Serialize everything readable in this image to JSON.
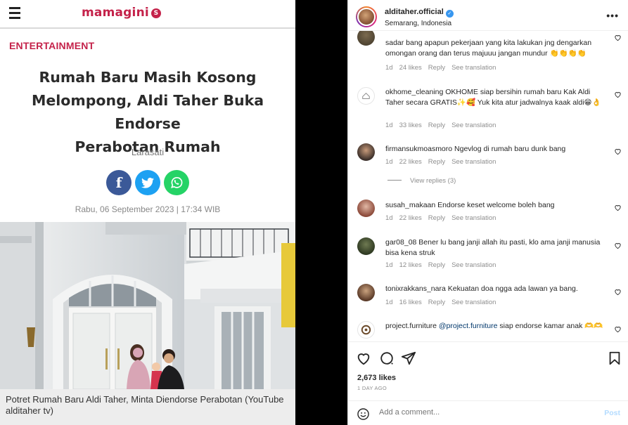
{
  "article": {
    "site_name": "mamagini",
    "logo_badge": "S",
    "category": "ENTERTAINMENT",
    "headline_lines": [
      "Rumah Baru Masih Kosong",
      "Melompong, Aldi Taher Buka Endorse",
      "Perabotan Rumah"
    ],
    "author": "Larasati",
    "share": {
      "facebook_glyph": "f"
    },
    "date": "Rabu, 06 September 2023 | 17:34 WIB",
    "caption": "Potret Rumah Baru Aldi Taher, Minta Diendorse Perabotan (YouTube alditaher tv)"
  },
  "instagram": {
    "username": "alditaher.official",
    "location": "Semarang, Indonesia",
    "more_label": "•••",
    "comments": [
      {
        "user": "",
        "text": "sadar bang apapun pekerjaan yang kita lakukan jng dengarkan omongan orang dan terus majuuu jangan mundur 👏👏👏👏",
        "time": "1d",
        "likes": "24 likes",
        "reply": "Reply",
        "translate": "See translation"
      },
      {
        "user": "okhome_cleaning",
        "text": "OKHOME siap bersihin rumah baru Kak Aldi Taher secara GRATIS✨🥰 Yuk kita atur jadwalnya kaak aldi😁👌",
        "time": "1d",
        "likes": "33 likes",
        "reply": "Reply",
        "translate": "See translation"
      },
      {
        "user": "firmansukmoasmoro",
        "text": "Ngevlog di rumah baru dunk bang",
        "time": "1d",
        "likes": "22 likes",
        "reply": "Reply",
        "translate": "See translation"
      },
      {
        "user": "susah_makaan",
        "text": "Endorse keset welcome boleh bang",
        "time": "1d",
        "likes": "22 likes",
        "reply": "Reply",
        "translate": "See translation"
      },
      {
        "user": "gar08_08",
        "text": "Bener lu bang janji allah itu pasti, klo ama janji manusia bisa kena struk",
        "time": "1d",
        "likes": "12 likes",
        "reply": "Reply",
        "translate": "See translation"
      },
      {
        "user": "tonixrakkans_nara",
        "text": "Kekuatan doa ngga ada lawan ya bang.",
        "time": "1d",
        "likes": "16 likes",
        "reply": "Reply",
        "translate": "See translation"
      },
      {
        "user": "project.furniture",
        "mention": "@project.furniture",
        "text": "siap endorse kamar anak 🫶🫶",
        "time": "",
        "likes": "",
        "reply": "",
        "translate": ""
      }
    ],
    "view_replies": "View replies (3)",
    "likes_total": "2,673 likes",
    "time_ago": "1 DAY AGO",
    "add_comment_placeholder": "Add a comment...",
    "post_label": "Post",
    "colors": {
      "link": "#00376b",
      "post_disabled": "#b3dbff",
      "verified": "#3897f0"
    }
  }
}
